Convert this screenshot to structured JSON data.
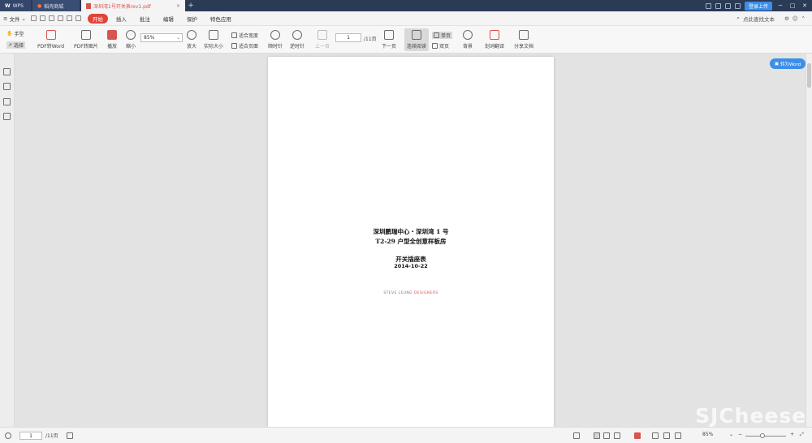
{
  "titlebar": {
    "tabs": [
      {
        "label": "WPS"
      },
      {
        "label": "稻壳商城"
      },
      {
        "label": "深圳湾1号开关表rev1.pdf"
      }
    ],
    "new_tab": "+",
    "login_label": "登录上传"
  },
  "menubar": {
    "file_label": "文件",
    "tabs": [
      {
        "label": "开始"
      },
      {
        "label": "插入"
      },
      {
        "label": "批注"
      },
      {
        "label": "编辑"
      },
      {
        "label": "保护"
      },
      {
        "label": "特色应用"
      }
    ],
    "search_label": "点此查找文本"
  },
  "ribbon": {
    "hand_label": "手型",
    "select_label": "选择",
    "pdf_to_word": "PDF转Word",
    "pdf_to_image": "PDF转图片",
    "play": "播放",
    "zoom_out": "缩小",
    "zoom_value": "85%",
    "zoom_in": "放大",
    "actual_size": "实际大小",
    "fit_width": "适合宽度",
    "fit_page": "适合页面",
    "rotate_cw": "顺时针",
    "rotate_ccw": "逆时针",
    "prev_page": "上一页",
    "page_current": "1",
    "page_total": "/11页",
    "next_page": "下一页",
    "continuous": "连续阅读",
    "single_page": "单页",
    "double_page": "双页",
    "background": "背景",
    "translate": "划词翻译",
    "share": "分享文档"
  },
  "document": {
    "line1": "深圳鹏瑞中心・深圳湾 1 号",
    "line2": "T2-29 户型全创意样板房",
    "line3": "开关插座表",
    "date": "2014-10-22",
    "brand_a": "STEVE LEUNG ",
    "brand_b": "DESIGNERS"
  },
  "to_word_button": "转为Word",
  "statusbar": {
    "page_current": "1",
    "page_total": "/11页",
    "zoom_value": "85%"
  },
  "watermark": "SJCheese",
  "colors": {
    "accent_red": "#e0433b",
    "accent_blue": "#3c8ee8",
    "titlebar": "#2b3a55"
  }
}
